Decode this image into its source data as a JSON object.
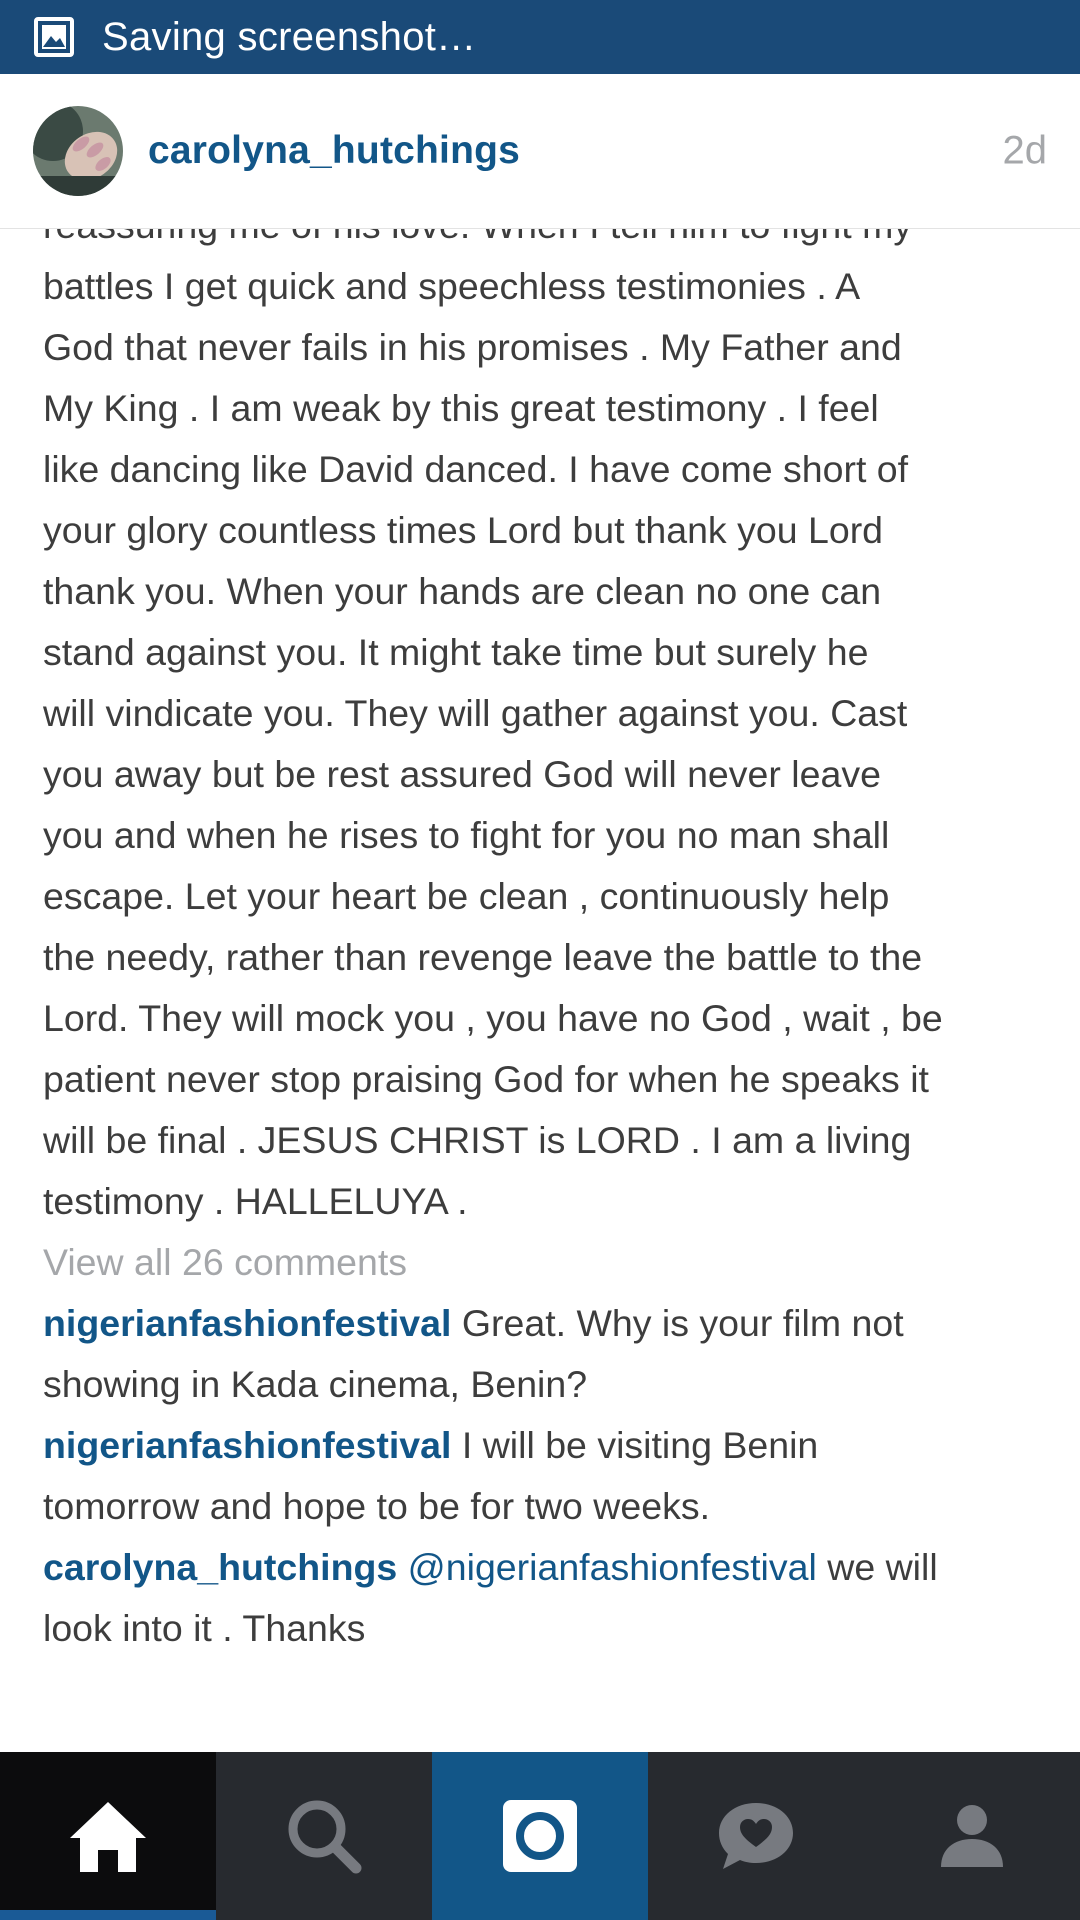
{
  "statusbar": {
    "text": "Saving screenshot…",
    "icon": "image-icon"
  },
  "post": {
    "username": "carolyna_hutchings",
    "time_ago": "2d",
    "caption_lines": [
      "reassuring me of his love. When I tell him to fight my",
      "battles I get quick and speechless testimonies . A",
      "God that never fails in his promises . My Father and",
      "My King . I am weak by this great testimony . I feel",
      "like dancing like David danced. I have come short of",
      "your glory countless times Lord but thank you Lord",
      "thank you. When your hands are clean no one can",
      "stand against you. It might take time but surely he",
      "will vindicate you. They will gather against you. Cast",
      "you away but be rest assured God will never leave",
      "you and when he rises to fight for you no man shall",
      "escape. Let your heart be clean , continuously help",
      "the needy, rather than revenge leave the battle to the",
      "Lord. They will mock you , you have no God , wait , be",
      "patient never stop praising God for when he speaks it",
      "will be final . JESUS CHRIST is LORD . I am a living",
      "testimony . HALLELUYA ."
    ],
    "view_all_comments": "View all 26 comments"
  },
  "comments": [
    {
      "user": "nigerianfashionfestival",
      "text_line1": " Great. Why is your film not",
      "text_line2": "showing in Kada cinema, Benin?"
    },
    {
      "user": "nigerianfashionfestival",
      "text_line1": " I will be visiting Benin",
      "text_line2": "tomorrow and hope to be for two weeks."
    },
    {
      "user": "carolyna_hutchings",
      "mention": " @nigerianfashionfestival",
      "text_line1": " we will",
      "text_line2": "look into it . Thanks"
    }
  ],
  "bottom_nav": {
    "tabs": [
      "home-icon",
      "search-icon",
      "camera-icon",
      "activity-heart-icon",
      "profile-icon"
    ],
    "active": "home-icon"
  },
  "colors": {
    "statusbar": "#1a4a78",
    "link": "#125688",
    "nav_background": "#272a2f",
    "camera_tab": "#125688"
  }
}
